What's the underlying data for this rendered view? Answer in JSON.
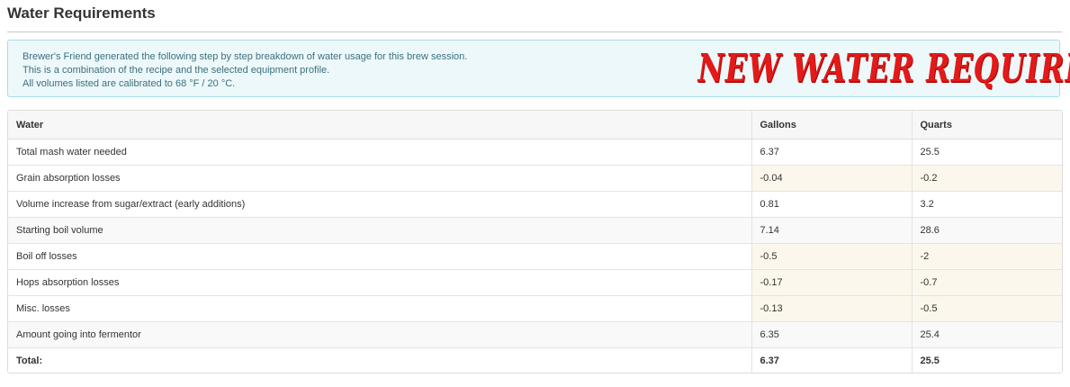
{
  "section": {
    "title": "Water Requirements"
  },
  "info": {
    "lines": [
      "Brewer's Friend generated the following step by step breakdown of water usage for this brew session.",
      "This is a combination of the recipe and the selected equipment profile.",
      "All volumes listed are calibrated to 68 °F / 20 °C."
    ],
    "banner_text": "NEW WATER REQUIREMENETS",
    "banner_color": "#e31a1a",
    "background_color": "#edf8fa",
    "border_color": "#a8dde6"
  },
  "table": {
    "headers": [
      "Water",
      "Gallons",
      "Quarts"
    ],
    "rows": [
      {
        "label": "Total mash water needed",
        "gallons": "6.37",
        "quarts": "25.5"
      },
      {
        "label": "Grain absorption losses",
        "gallons": "-0.04",
        "quarts": "-0.2"
      },
      {
        "label": "Volume increase from sugar/extract (early additions)",
        "gallons": "0.81",
        "quarts": "3.2"
      },
      {
        "label": "Starting boil volume",
        "gallons": "7.14",
        "quarts": "28.6"
      },
      {
        "label": "Boil off losses",
        "gallons": "-0.5",
        "quarts": "-2"
      },
      {
        "label": "Hops absorption losses",
        "gallons": "-0.17",
        "quarts": "-0.7"
      },
      {
        "label": "Misc. losses",
        "gallons": "-0.13",
        "quarts": "-0.5"
      },
      {
        "label": "Amount going into fermentor",
        "gallons": "6.35",
        "quarts": "25.4"
      }
    ],
    "total": {
      "label": "Total:",
      "gallons": "6.37",
      "quarts": "25.5"
    },
    "loss_highlight_color": "#fcf7ec"
  }
}
